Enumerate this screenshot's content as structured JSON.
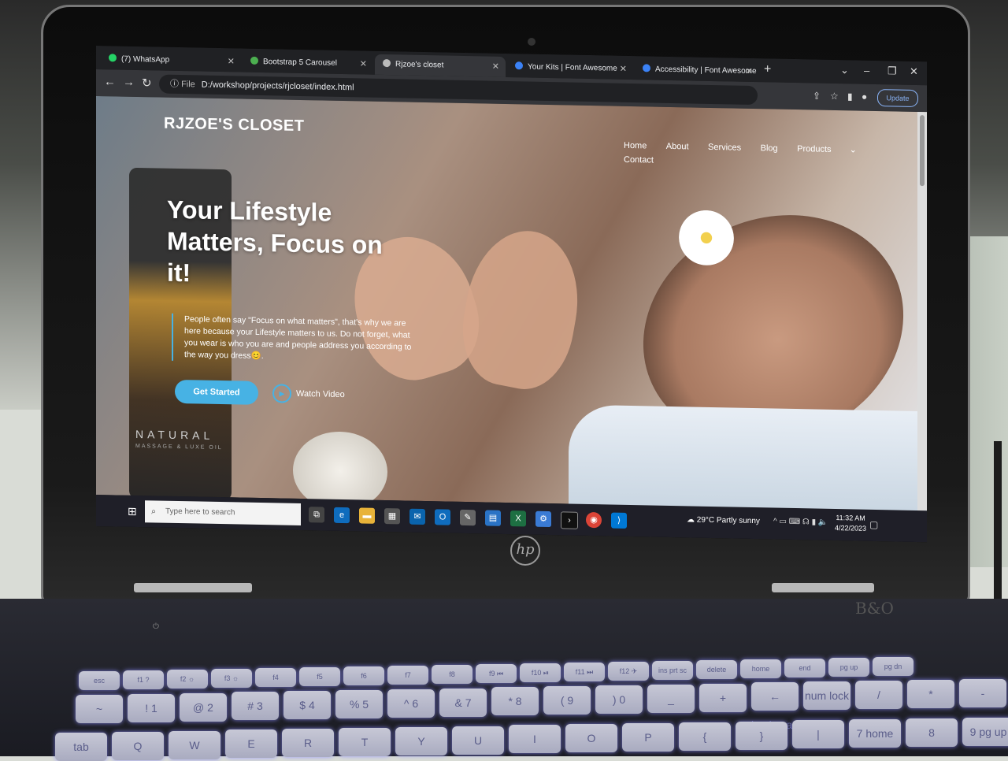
{
  "browser": {
    "tabs": [
      {
        "title": "(7) WhatsApp",
        "icon": "whatsapp-icon",
        "color": "#25d366"
      },
      {
        "title": "Bootstrap 5 Carousel",
        "icon": "w3schools-icon",
        "color": "#4caf50"
      },
      {
        "title": "Rjzoe's closet",
        "icon": "globe-icon",
        "color": "#bbbbbb",
        "active": true
      },
      {
        "title": "Your Kits | Font Awesome",
        "icon": "flag-icon",
        "color": "#3b82f6"
      },
      {
        "title": "Accessibility | Font Awesome Do",
        "icon": "flag-icon",
        "color": "#3b82f6"
      }
    ],
    "new_tab": "+",
    "address": {
      "scheme_label": "File",
      "url": "D:/workshop/projects/rjcloset/index.html"
    },
    "update_label": "Update"
  },
  "site": {
    "brand": "RJZOE'S CLOSET",
    "nav": [
      "Home",
      "About",
      "Services",
      "Blog",
      "Products",
      "Contact"
    ],
    "headline": "Your Lifestyle Matters, Focus on it!",
    "description": "People often say \"Focus on what matters\", that's why we are here because your Lifestyle matters to us. Do not forget, what you wear is who you are and people address you according to the way you dress😊.",
    "cta_label": "Get Started",
    "watch_label": "Watch Video",
    "bottle_label": "NATURAL",
    "bottle_sublabel": "MASSAGE & LUXE OIL",
    "accent_color": "#47b2e4"
  },
  "taskbar": {
    "search_placeholder": "Type here to search",
    "weather": "29°C  Partly sunny",
    "time": "11:32 AM",
    "date": "4/22/2023"
  },
  "keyboard": {
    "fn_row": [
      "esc",
      "f1 ?",
      "f2 ☼",
      "f3 ☼",
      "f4",
      "f5",
      "f6",
      "f7",
      "f8",
      "f9 ⏮",
      "f10 ⏯",
      "f11 ⏭",
      "f12 ✈",
      "ins prt sc",
      "delete",
      "home",
      "end",
      "pg up",
      "pg dn"
    ],
    "num_row": [
      "~",
      "!\n1",
      "@\n2",
      "#\n3",
      "$\n4",
      "%\n5",
      "^\n6",
      "&\n7",
      "*\n8",
      "(\n9",
      ")\n0",
      "_",
      "+",
      "← backspace",
      "num lock",
      "/",
      "*",
      "-"
    ],
    "letter_row": [
      "tab",
      "Q",
      "W",
      "E",
      "R",
      "T",
      "Y",
      "U",
      "I",
      "O",
      "P",
      "{",
      "}",
      "|",
      "7 home",
      "8",
      "9 pg up"
    ]
  }
}
